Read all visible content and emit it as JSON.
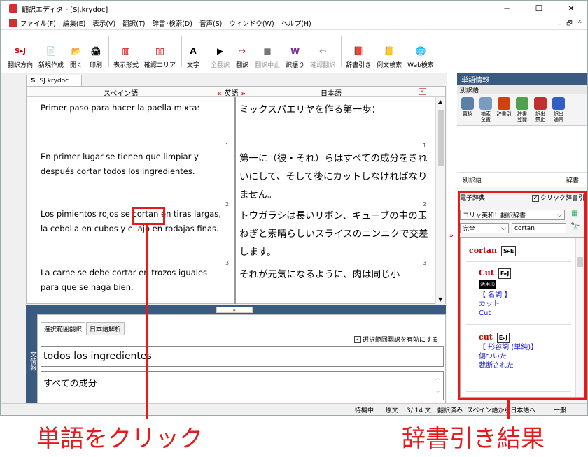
{
  "window": {
    "title": "翻訳エディタ - [SJ.krydoc]",
    "min": "─",
    "max": "☐",
    "close": "✕"
  },
  "menu": [
    "ファイル(F)",
    "編集(E)",
    "表示(V)",
    "翻訳(T)",
    "辞書･検索(D)",
    "音声(S)",
    "ウィンドウ(W)",
    "ヘルプ(H)"
  ],
  "mdi": {
    "min": "_",
    "restore": "🗗",
    "close": "x"
  },
  "toolbar": [
    {
      "icon": "S▸J",
      "label": "翻訳方向"
    },
    {
      "icon": "📄",
      "label": "新規作成"
    },
    {
      "icon": "📂",
      "label": "開く"
    },
    {
      "icon": "🖨",
      "label": "印刷"
    },
    {
      "icon": "▥",
      "label": "表示形式"
    },
    {
      "icon": "▯▯",
      "label": "確認エリア"
    },
    {
      "icon": "A",
      "label": "文字"
    },
    {
      "icon": "▶",
      "label": "全翻訳"
    },
    {
      "icon": "⇨",
      "label": "翻訳"
    },
    {
      "icon": "■",
      "label": "翻訳中止"
    },
    {
      "icon": "W",
      "label": "訳振り"
    },
    {
      "icon": "⇦",
      "label": "確認翻訳"
    },
    {
      "icon": "📕",
      "label": "辞書引き"
    },
    {
      "icon": "📒",
      "label": "例文検索"
    },
    {
      "icon": "🌐",
      "label": "Web検索"
    }
  ],
  "doc_tab": {
    "badge": "S",
    "name": "SJ.krydoc"
  },
  "editor": {
    "src_header": "スペイン語",
    "dst_header": "日本語",
    "arrow_left": "«",
    "mid_label": "英語",
    "arrow_right": "»",
    "collapse": "«",
    "segments": [
      {
        "src": "Primer paso para hacer la paella mixta:",
        "dst": "ミックスパエリヤを作る第一歩：",
        "num": "1"
      },
      {
        "src": "En primer lugar se tienen que limpiar y después cortar todos los ingredientes.",
        "dst": "第一に（彼・それ）らはすべての成分をきれいにして、そして後にカットしなければなりません。",
        "num": "2"
      },
      {
        "src": "Los pimientos rojos se cortan en tiras largas, la cebolla en cubos y el ajo en rodajas finas.",
        "dst": "トウガラシは長いリボン、キューブの中の玉ねぎと素晴らしいスライスのニンニクで交差します。",
        "num": "3"
      },
      {
        "src": "La carne se debe cortar en trozos  iguales para que se haga bien.",
        "dst": "それが元気になるように、肉は同じ小",
        "num": ""
      }
    ]
  },
  "split_btn": "»",
  "bottom_nav": "文情報",
  "bottom": {
    "tabs": [
      "選択範囲翻訳",
      "日本語解析"
    ],
    "checkbox": "選択範囲翻訳を有効にする",
    "src": "todos los ingredientes",
    "dst": "すべての成分"
  },
  "word_panel": {
    "title": "単語情報",
    "betsu_header": "別訳語",
    "tools": [
      {
        "label": "置換",
        "color": "#5b7fa8"
      },
      {
        "label": "検索\n全置",
        "color": "#7a9cc0"
      },
      {
        "label": "辞書引",
        "color": "#d04010"
      },
      {
        "label": "辞書\n登録",
        "color": "#50a050"
      },
      {
        "label": "訳出\n禁止",
        "color": "#c03030"
      },
      {
        "label": "訳出\n通常",
        "color": "#3060c0"
      }
    ],
    "betsu_col1": "別訳語",
    "betsu_col2": "辞書",
    "dict_label": "電子辞典",
    "click_dict": "クリック辞書引",
    "dict_select": "コリャ英和！翻訳辞書",
    "match_select": "完全",
    "search_value": "cortan",
    "results": {
      "headword": "cortan",
      "headword_tag": "S▸E",
      "e1_word": "Cut",
      "e1_tag": "E▸J",
      "e1_pos": "活用形",
      "e1_cat": "【 名詞 】",
      "e1_kana": "カット",
      "e1_trans": "Cut",
      "e2_word": "cut",
      "e2_tag": "E▸J",
      "e2_cat": "【 形容詞 (単純)】",
      "e2_t1": "傷ついた",
      "e2_t2": "裁断された"
    }
  },
  "status": {
    "s1": "待機中",
    "s2": "原文",
    "s3": "3/ 14 文",
    "s4": "翻訳済み",
    "s5": "スペイン語から日本語へ",
    "s6": "一般"
  },
  "callouts": {
    "left": "単語をクリック",
    "right": "辞書引き結果"
  },
  "colors": {
    "accent": "#e31b1b",
    "panel_header": "#3a5a80"
  }
}
